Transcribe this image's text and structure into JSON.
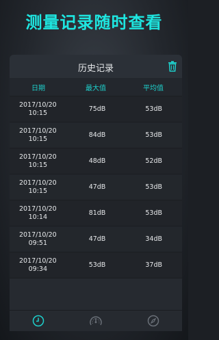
{
  "headline": "测量记录随时查看",
  "card": {
    "title": "历史记录",
    "trash_icon": "trash-icon"
  },
  "columns": [
    "日期",
    "最大值",
    "平均值"
  ],
  "records": [
    {
      "date": "2017/10/20",
      "time": "10:15",
      "max": "75dB",
      "avg": "53dB"
    },
    {
      "date": "2017/10/20",
      "time": "10:15",
      "max": "84dB",
      "avg": "53dB"
    },
    {
      "date": "2017/10/20",
      "time": "10:15",
      "max": "48dB",
      "avg": "52dB"
    },
    {
      "date": "2017/10/20",
      "time": "10:15",
      "max": "47dB",
      "avg": "53dB"
    },
    {
      "date": "2017/10/20",
      "time": "10:14",
      "max": "81dB",
      "avg": "53dB"
    },
    {
      "date": "2017/10/20",
      "time": "09:51",
      "max": "47dB",
      "avg": "34dB"
    },
    {
      "date": "2017/10/20",
      "time": "09:34",
      "max": "53dB",
      "avg": "37dB"
    }
  ],
  "nav": [
    {
      "icon": "history-clock-icon",
      "active": true
    },
    {
      "icon": "gauge-icon",
      "active": false
    },
    {
      "icon": "compass-icon",
      "active": false
    }
  ],
  "colors": {
    "accent": "#1ee6e0",
    "active_icon": "#1ed0cc",
    "inactive_icon": "#6a7078"
  }
}
